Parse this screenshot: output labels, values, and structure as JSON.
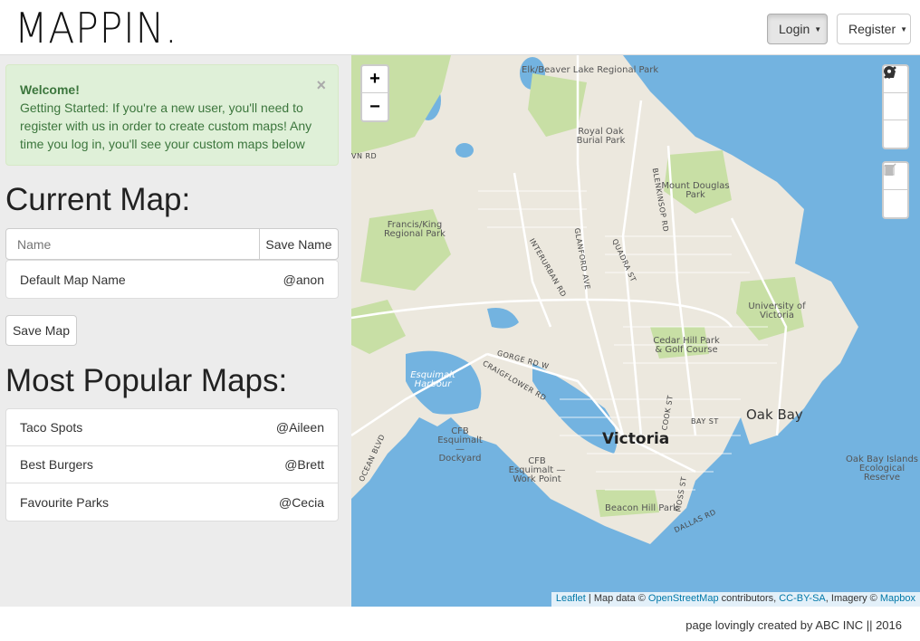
{
  "header": {
    "logo": "MAPPIN.",
    "login_label": "Login",
    "register_label": "Register"
  },
  "sidebar": {
    "alert": {
      "title": "Welcome!",
      "text": "Getting Started: If you're a new user, you'll need to register with us in order to create custom maps! Any time you log in, you'll see your custom maps below",
      "close": "×"
    },
    "current_heading": "Current Map:",
    "name_placeholder": "Name",
    "save_name_label": "Save Name",
    "current_map": {
      "name": "Default Map Name",
      "owner": "@anon"
    },
    "save_map_label": "Save Map",
    "popular_heading": "Most Popular Maps:",
    "popular_maps": [
      {
        "name": "Taco Spots",
        "owner": "@Aileen"
      },
      {
        "name": "Best Burgers",
        "owner": "@Brett"
      },
      {
        "name": "Favourite Parks",
        "owner": "@Cecia"
      }
    ]
  },
  "map": {
    "zoom_in": "+",
    "zoom_out": "−",
    "labels": {
      "elk_lake": "Elk/Beaver Lake Regional Park",
      "royal_oak": "Royal Oak Burial Park",
      "mount_douglas": "Mount Douglas Park",
      "francis_king": "Francis/King Regional Park",
      "university": "University of Victoria",
      "cedar_hill": "Cedar Hill Park & Golf Course",
      "esquimalt_harbour": "Esquimalt Harbour",
      "oak_bay": "Oak Bay",
      "victoria": "Victoria",
      "cfb_dockyard": "CFB Esquimalt — Dockyard",
      "cfb_workpoint": "CFB Esquimalt — Work Point",
      "beacon_hill": "Beacon Hill Park",
      "oak_bay_islands": "Oak Bay Islands Ecological Reserve",
      "interurban": "INTERURBAN RD",
      "glanford": "GLANFORD AVE",
      "quadra": "QUADRA ST",
      "blenkinsop": "BLENKINSOP RD",
      "gorge": "GORGE RD W",
      "craigflower": "CRAIGFLOWER RD",
      "cook": "COOK ST",
      "bay": "BAY ST",
      "moss": "MOSS ST",
      "dallas": "DALLAS RD",
      "ocean": "OCEAN BLVD",
      "vn_rd": "VN RD"
    },
    "attribution": {
      "leaflet": "Leaflet",
      "sep1": " | Map data © ",
      "osm": "OpenStreetMap",
      "sep2": " contributors, ",
      "license": "CC-BY-SA",
      "sep3": ", Imagery © ",
      "mapbox": "Mapbox"
    }
  },
  "footer": {
    "text": "page lovingly created by ABC INC || 2016"
  },
  "colors": {
    "water": "#73b3e0",
    "land": "#ece8de",
    "park": "#c8dfa5",
    "alert_bg": "#dff0d8",
    "alert_text": "#3c763d",
    "link": "#0078a8"
  }
}
